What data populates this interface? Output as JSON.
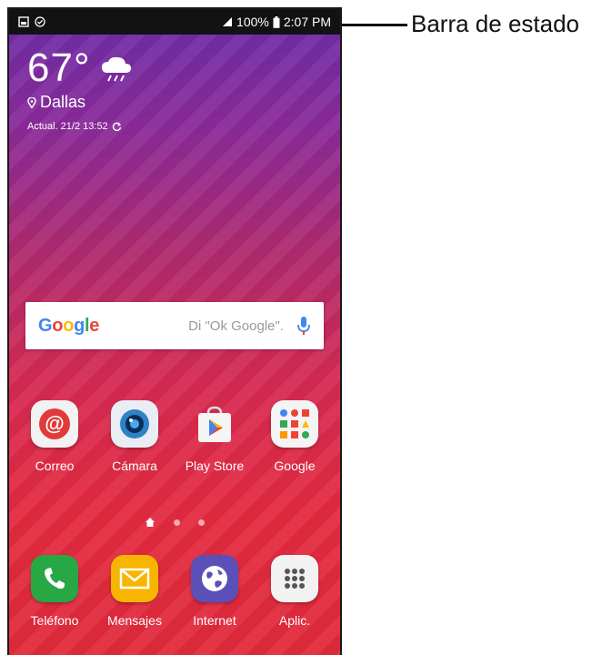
{
  "status_bar": {
    "battery": "100%",
    "time": "2:07 PM",
    "icons": [
      "gallery-notification-icon",
      "check-circle-icon",
      "signal-icon",
      "battery-icon"
    ]
  },
  "weather": {
    "temperature": "67°",
    "city": "Dallas",
    "updated": "Actual. 21/2 13:52",
    "icons": [
      "cloud-rain-icon",
      "location-pin-icon",
      "refresh-icon"
    ]
  },
  "search": {
    "logo": "Google",
    "hint": "Di \"Ok Google\".",
    "icon": "microphone-icon"
  },
  "apps_row1": [
    {
      "label": "Correo",
      "icon": "email-icon",
      "color": "#e23a3a"
    },
    {
      "label": "Cámara",
      "icon": "camera-icon",
      "color": "#2f82c6"
    },
    {
      "label": "Play Store",
      "icon": "play-store-icon",
      "color": "#ffffff"
    },
    {
      "label": "Google",
      "icon": "google-folder-icon",
      "color": "#ffffff"
    }
  ],
  "apps_row2": [
    {
      "label": "Teléfono",
      "icon": "phone-icon",
      "color": "#28a745"
    },
    {
      "label": "Mensajes",
      "icon": "messages-icon",
      "color": "#f7b500"
    },
    {
      "label": "Internet",
      "icon": "internet-icon",
      "color": "#5b4fb8"
    },
    {
      "label": "Aplic.",
      "icon": "apps-grid-icon",
      "color": "#ffffff"
    }
  ],
  "page_indicator": [
    "home",
    "page",
    "page"
  ],
  "annotation": {
    "label": "Barra de estado"
  }
}
